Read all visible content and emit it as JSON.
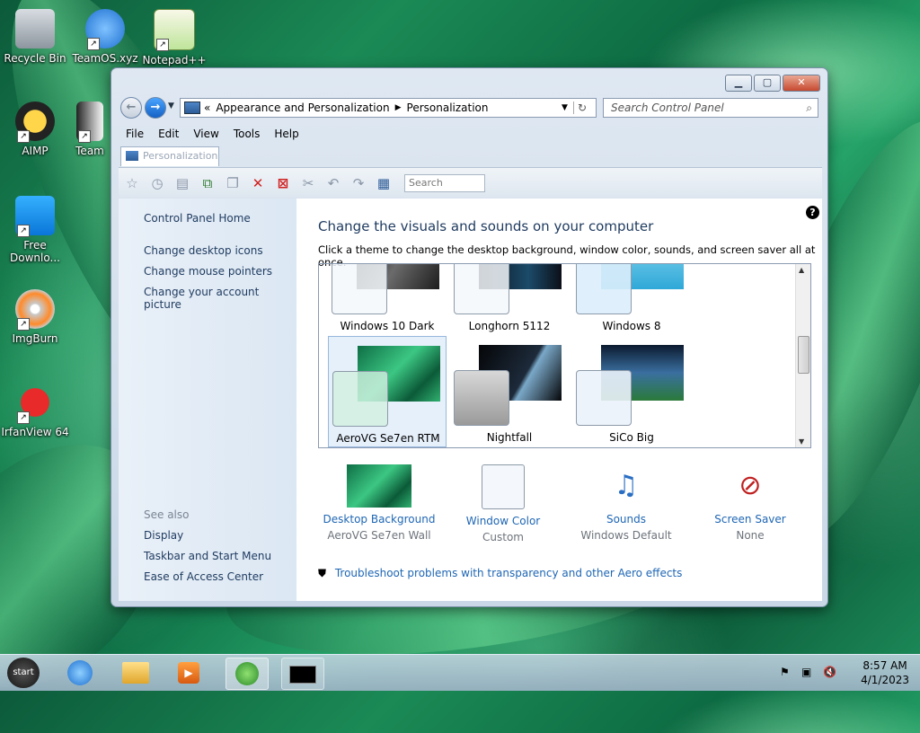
{
  "desktop": {
    "icons": [
      {
        "label": "Recycle Bin"
      },
      {
        "label": "TeamOS.xyz"
      },
      {
        "label": "Notepad++"
      },
      {
        "label": "AIMP"
      },
      {
        "label": "Team"
      },
      {
        "label": "Free Downlo..."
      },
      {
        "label": "ImgBurn"
      },
      {
        "label": "IrfanView 64"
      }
    ]
  },
  "window": {
    "address": {
      "segments": [
        "Appearance and Personalization",
        "Personalization"
      ],
      "overflow": "«"
    },
    "search_placeholder": "Search Control Panel",
    "menu": [
      "File",
      "Edit",
      "View",
      "Tools",
      "Help"
    ],
    "tab_label": "Personalization",
    "toolbar_search": "Search",
    "left_pane": {
      "home": "Control Panel Home",
      "links": [
        "Change desktop icons",
        "Change mouse pointers",
        "Change your account picture"
      ],
      "see_also_title": "See also",
      "see_also": [
        "Display",
        "Taskbar and Start Menu",
        "Ease of Access Center"
      ]
    },
    "main": {
      "heading": "Change the visuals and sounds on your computer",
      "subtitle": "Click a theme to change the desktop background, window color, sounds, and screen saver all at once.",
      "themes": [
        {
          "name": "Windows 10 Dark",
          "selected": false
        },
        {
          "name": "Longhorn 5112",
          "selected": false
        },
        {
          "name": "Windows 8",
          "selected": false
        },
        {
          "name": "AeroVG Se7en RTM",
          "selected": true
        },
        {
          "name": "Nightfall",
          "selected": false
        },
        {
          "name": "SiCo Big",
          "selected": false
        }
      ],
      "settings": [
        {
          "label": "Desktop Background",
          "value": "AeroVG Se7en Wall"
        },
        {
          "label": "Window Color",
          "value": "Custom"
        },
        {
          "label": "Sounds",
          "value": "Windows Default"
        },
        {
          "label": "Screen Saver",
          "value": "None"
        }
      ],
      "troubleshoot": "Troubleshoot problems with transparency and other Aero effects"
    }
  },
  "taskbar": {
    "start_label": "start",
    "time": "8:57 AM",
    "date": "4/1/2023"
  },
  "colors": {
    "link": "#1e66b4",
    "heading": "#1e3a5f",
    "selection": "#e6f0fb"
  }
}
